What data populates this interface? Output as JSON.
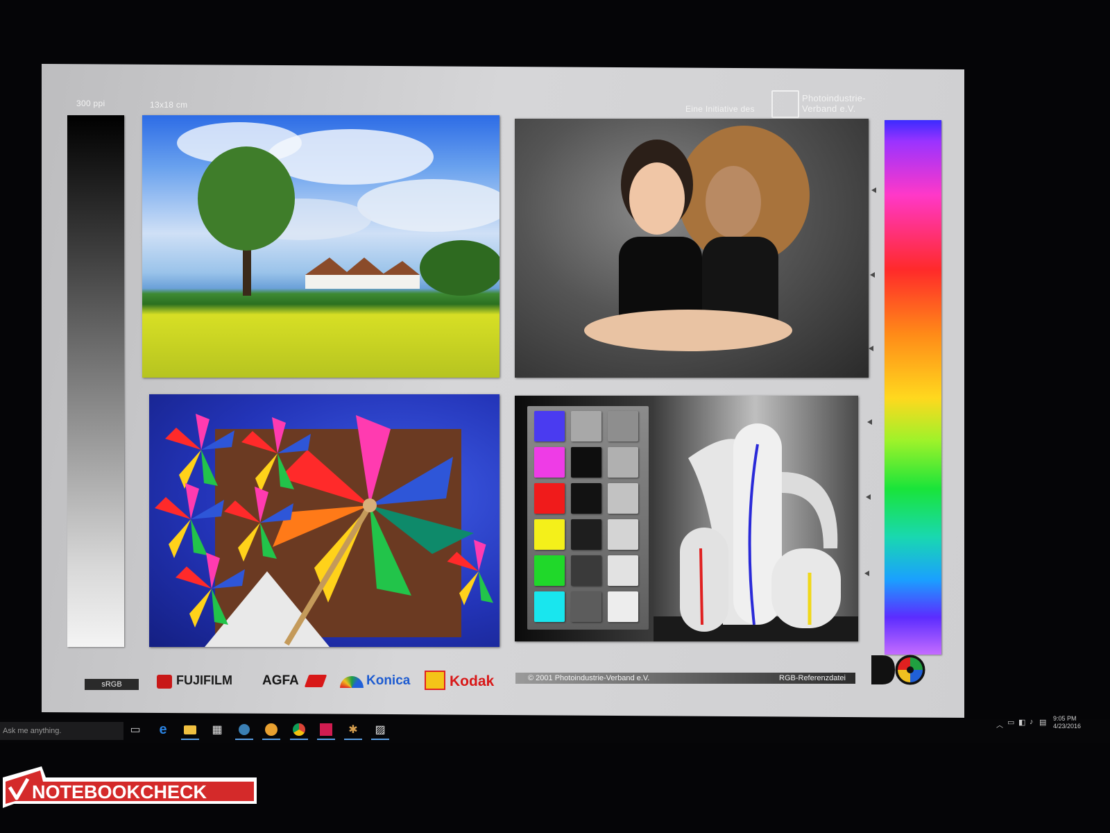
{
  "test_chart": {
    "resolution_label": "300 ppi",
    "size_label": "13x18 cm",
    "initiative_label": "Eine Initiative des",
    "association_name_line1": "Photoindustrie-",
    "association_name_line2": "Verband e.V.",
    "color_space_label": "sRGB",
    "brands": [
      "FUJIFILM",
      "AGFA",
      "Konica",
      "Kodak"
    ],
    "copyright": "© 2001  Photoindustrie-Verband e.V.",
    "file_label": "RGB-Referenzdatei",
    "patches": {
      "colors": [
        "#4a3bf0",
        "#ee3ce6",
        "#f01b1b",
        "#f4f01a",
        "#20d82a",
        "#19e6ee"
      ],
      "center": [
        "#a8a8a8",
        "#0e0e0e",
        "#121212",
        "#1e1e1e",
        "#3a3a3a",
        "#5c5c5c"
      ],
      "right": [
        "#8e8e8e",
        "#b0b0b0",
        "#c2c2c2",
        "#d4d4d4",
        "#e2e2e2",
        "#ededed"
      ]
    }
  },
  "taskbar": {
    "search_placeholder": "Ask me anything.",
    "icons": [
      "task-view-icon",
      "edge-icon",
      "file-explorer-icon",
      "store-icon",
      "steam-icon",
      "app-icon",
      "chrome-icon",
      "photoshop-icon",
      "game-icon",
      "photos-icon"
    ],
    "clock_time": "9:05 PM",
    "clock_date": "4/23/2016"
  },
  "watermark": {
    "text": "NOTEBOOKCHECK"
  }
}
